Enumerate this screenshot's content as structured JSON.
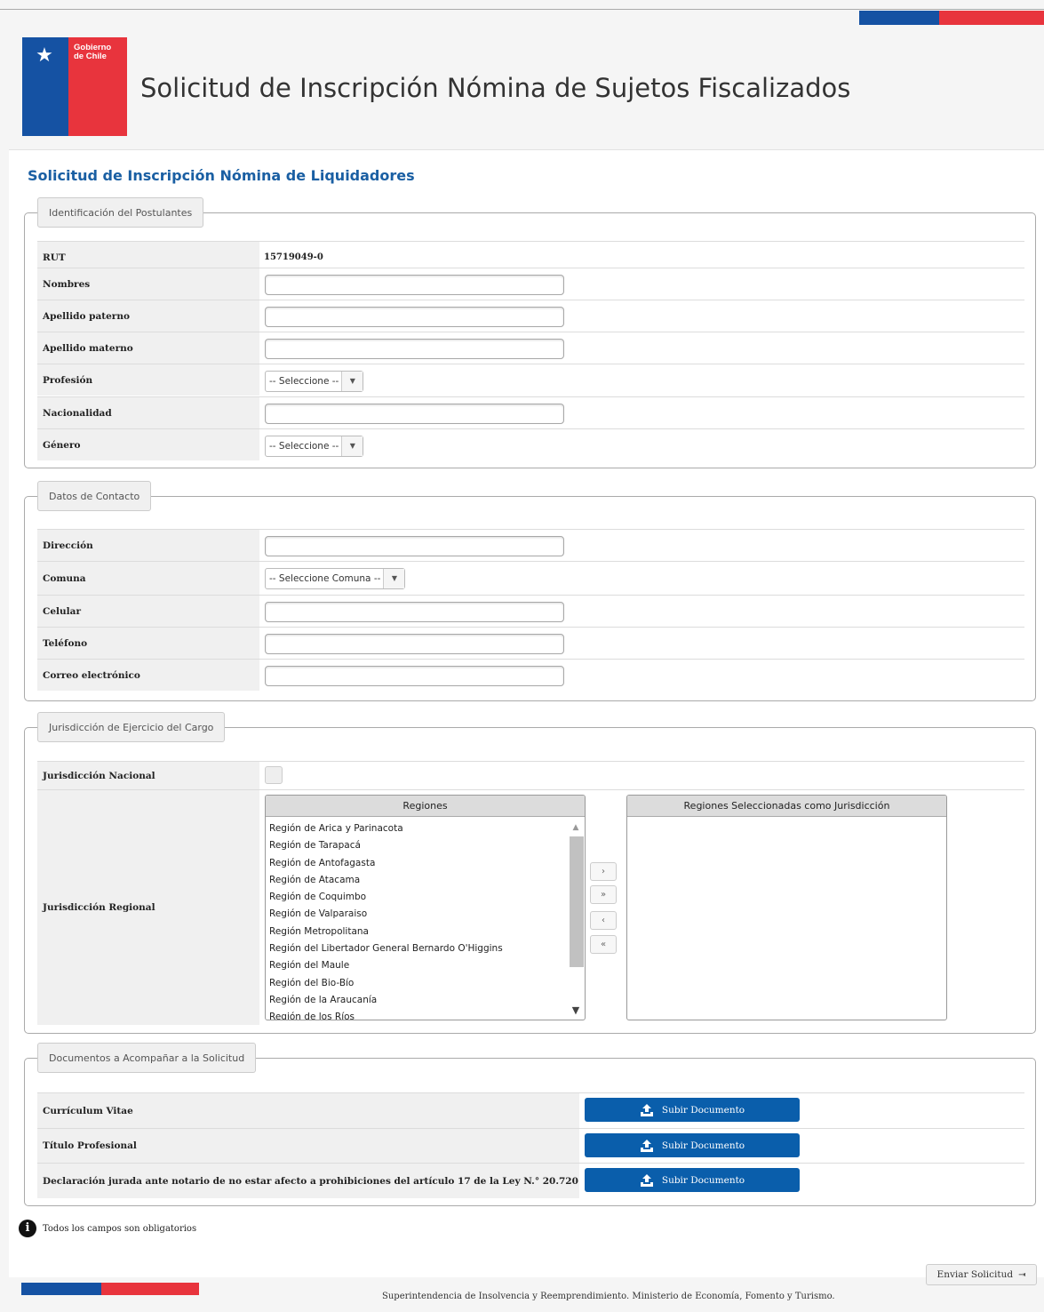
{
  "header": {
    "logo_line1": "Gobierno",
    "logo_line2": "de Chile",
    "site_title": "Solicitud de Inscripción Nómina de Sujetos Fiscalizados"
  },
  "form_title": "Solicitud de Inscripción Nómina de Liquidadores",
  "section_identificacion": {
    "legend": "Identificación del Postulantes",
    "rut_label": "RUT",
    "rut_value": "15719049-0",
    "nombres_label": "Nombres",
    "apellido_paterno_label": "Apellido paterno",
    "apellido_materno_label": "Apellido materno",
    "profesion_label": "Profesión",
    "profesion_selected": "-- Seleccione --",
    "nacionalidad_label": "Nacionalidad",
    "genero_label": "Género",
    "genero_selected": "-- Seleccione --"
  },
  "section_contacto": {
    "legend": "Datos de Contacto",
    "direccion_label": "Dirección",
    "comuna_label": "Comuna",
    "comuna_selected": "-- Seleccione Comuna --",
    "celular_label": "Celular",
    "telefono_label": "Teléfono",
    "correo_label": "Correo electrónico"
  },
  "section_jurisdiccion": {
    "legend": "Jurisdicción de Ejercicio del Cargo",
    "nacional_label": "Jurisdicción Nacional",
    "regional_label": "Jurisdicción Regional",
    "regiones_header": "Regiones",
    "seleccionadas_header": "Regiones Seleccionadas como Jurisdicción",
    "regiones": [
      "Región de Arica y Parinacota",
      "Región de Tarapacá",
      "Región de Antofagasta",
      "Región de Atacama",
      "Región de Coquimbo",
      "Región de Valparaiso",
      "Región Metropolitana",
      "Región del Libertador General Bernardo O'Higgins",
      "Región del Maule",
      "Región del Bio-Bío",
      "Región de la Araucanía",
      "Región de los Ríos"
    ],
    "move_buttons": [
      "›",
      "»",
      "‹",
      "«"
    ]
  },
  "section_documentos": {
    "legend": "Documentos a Acompañar a la Solicitud",
    "rows": [
      {
        "label": "Currículum Vitae",
        "button": "Subir Documento"
      },
      {
        "label": "Título Profesional",
        "button": "Subir Documento"
      },
      {
        "label": "Declaración jurada ante notario de no estar afecto a prohibiciones del artículo 17 de la Ley N.° 20.720",
        "button": "Subir Documento"
      }
    ]
  },
  "note": "Todos los campos son obligatorios",
  "submit_label": "Enviar Solicitud",
  "footer_text": "Superintendencia de Insolvencia y Reemprendimiento. Ministerio de Economía, Fomento y Turismo.",
  "colors": {
    "brand_blue": "#1552a3",
    "brand_red": "#e8343d",
    "title_blue": "#1a5fa3",
    "button_blue": "#0a5eab"
  },
  "icons": {
    "info": "info-icon",
    "upload": "upload-icon",
    "submit": "sign-in-icon",
    "dropdown": "caret-down-icon"
  }
}
